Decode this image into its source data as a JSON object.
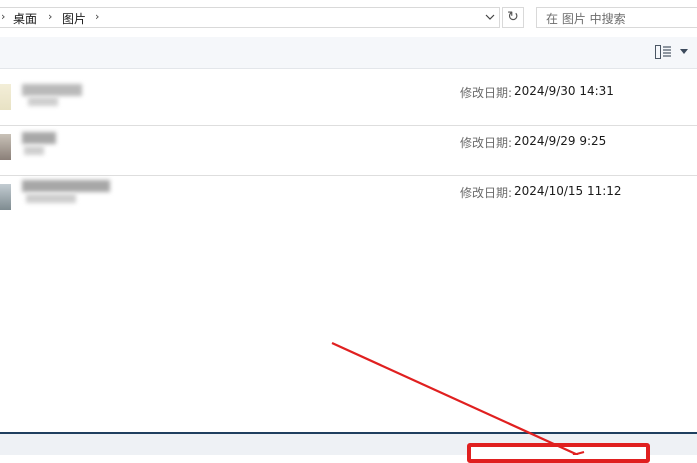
{
  "address_bar": {
    "breadcrumbs": [
      "桌面",
      "图片"
    ]
  },
  "search": {
    "placeholder": "在 图片 中搜索"
  },
  "files": [
    {
      "name": "",
      "modified_label": "修改日期:",
      "modified": "2024/9/30 14:31"
    },
    {
      "name": "",
      "modified_label": "修改日期:",
      "modified": "2024/9/29 9:25"
    },
    {
      "name": "",
      "modified_label": "修改日期:",
      "modified": "2024/10/15 11:12"
    }
  ],
  "icons": {
    "breadcrumb_separator": "chevron-right-icon",
    "history": "chevron-down-icon",
    "refresh": "refresh-icon",
    "view": "details-view-icon",
    "view_menu": "caret-down-icon"
  },
  "colors": {
    "annotation": "#e02020",
    "divider": "#1f3f5f"
  }
}
